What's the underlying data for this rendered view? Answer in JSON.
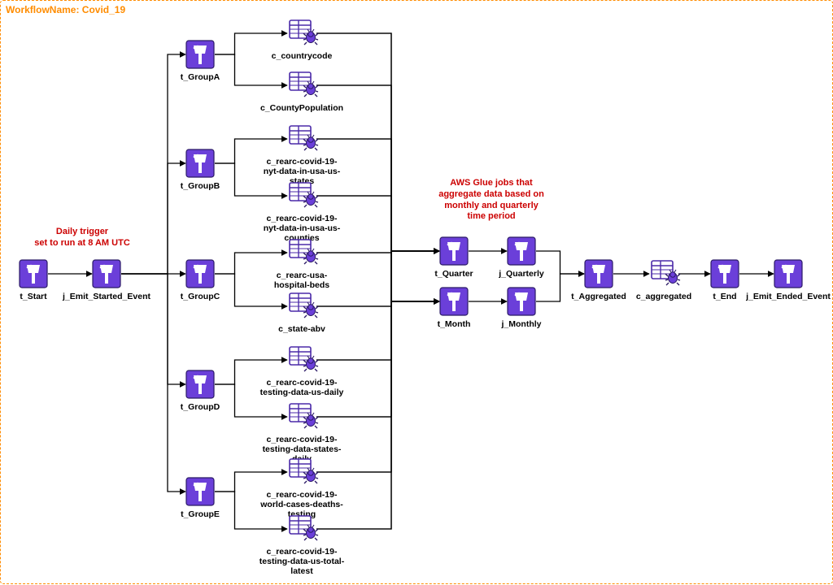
{
  "workflow": {
    "name_label": "WorkflowName:  Covid_19"
  },
  "annotations": {
    "daily_trigger": "Daily trigger\nset to run at 8 AM UTC",
    "aggregate_desc": "AWS Glue jobs that\naggregate data based on\nmonthly and quarterly\ntime period"
  },
  "nodes": {
    "t_Start": {
      "label": "t_Start",
      "kind": "trigger"
    },
    "j_Emit_Started_Event": {
      "label": "j_Emit_Started_Event",
      "kind": "trigger"
    },
    "t_GroupA": {
      "label": "t_GroupA",
      "kind": "trigger"
    },
    "t_GroupB": {
      "label": "t_GroupB",
      "kind": "trigger"
    },
    "t_GroupC": {
      "label": "t_GroupC",
      "kind": "trigger"
    },
    "t_GroupD": {
      "label": "t_GroupD",
      "kind": "trigger"
    },
    "t_GroupE": {
      "label": "t_GroupE",
      "kind": "trigger"
    },
    "c_countrycode": {
      "label": "c_countrycode",
      "kind": "crawler"
    },
    "c_CountyPopulation": {
      "label": "c_CountyPopulation",
      "kind": "crawler"
    },
    "c_rearc_nyt_states": {
      "label": "c_rearc-covid-19-\nnyt-data-in-usa-us-states",
      "kind": "crawler"
    },
    "c_rearc_nyt_counties": {
      "label": "c_rearc-covid-19-\nnyt-data-in-usa-us-counties",
      "kind": "crawler"
    },
    "c_rearc_hospital_beds": {
      "label": "c_rearc-usa-\nhospital-beds",
      "kind": "crawler"
    },
    "c_state_abv": {
      "label": "c_state-abv",
      "kind": "crawler"
    },
    "c_testing_us_daily": {
      "label": "c_rearc-covid-19-\ntesting-data-us-daily",
      "kind": "crawler"
    },
    "c_testing_states_daily": {
      "label": "c_rearc-covid-19-\ntesting-data-states-daily",
      "kind": "crawler"
    },
    "c_world_cases": {
      "label": "c_rearc-covid-19-\nworld-cases-deaths-testing",
      "kind": "crawler"
    },
    "c_testing_total_latest": {
      "label": "c_rearc-covid-19-\ntesting-data-us-total-latest",
      "kind": "crawler"
    },
    "t_Quarter": {
      "label": "t_Quarter",
      "kind": "trigger"
    },
    "j_Quarterly": {
      "label": "j_Quarterly",
      "kind": "trigger"
    },
    "t_Month": {
      "label": "t_Month",
      "kind": "trigger"
    },
    "j_Monthly": {
      "label": "j_Monthly",
      "kind": "trigger"
    },
    "t_Aggregated": {
      "label": "t_Aggregated",
      "kind": "trigger"
    },
    "c_aggregated": {
      "label": "c_aggregated",
      "kind": "crawler"
    },
    "t_End": {
      "label": "t_End",
      "kind": "trigger"
    },
    "j_Emit_Ended_Event": {
      "label": "j_Emit_Ended_Event",
      "kind": "trigger"
    }
  },
  "edges": [
    [
      "t_Start",
      "j_Emit_Started_Event"
    ],
    [
      "j_Emit_Started_Event",
      "t_GroupA"
    ],
    [
      "j_Emit_Started_Event",
      "t_GroupB"
    ],
    [
      "j_Emit_Started_Event",
      "t_GroupC"
    ],
    [
      "j_Emit_Started_Event",
      "t_GroupD"
    ],
    [
      "j_Emit_Started_Event",
      "t_GroupE"
    ],
    [
      "t_GroupA",
      "c_countrycode"
    ],
    [
      "t_GroupA",
      "c_CountyPopulation"
    ],
    [
      "t_GroupB",
      "c_rearc_nyt_states"
    ],
    [
      "t_GroupB",
      "c_rearc_nyt_counties"
    ],
    [
      "t_GroupC",
      "c_rearc_hospital_beds"
    ],
    [
      "t_GroupC",
      "c_state_abv"
    ],
    [
      "t_GroupD",
      "c_testing_us_daily"
    ],
    [
      "t_GroupD",
      "c_testing_states_daily"
    ],
    [
      "t_GroupE",
      "c_world_cases"
    ],
    [
      "t_GroupE",
      "c_testing_total_latest"
    ],
    [
      "c_countrycode",
      "t_Quarter"
    ],
    [
      "c_CountyPopulation",
      "t_Quarter"
    ],
    [
      "c_rearc_nyt_states",
      "t_Quarter"
    ],
    [
      "c_rearc_nyt_counties",
      "t_Quarter"
    ],
    [
      "c_rearc_hospital_beds",
      "t_Quarter"
    ],
    [
      "c_state_abv",
      "t_Quarter"
    ],
    [
      "c_testing_us_daily",
      "t_Quarter"
    ],
    [
      "c_testing_states_daily",
      "t_Quarter"
    ],
    [
      "c_world_cases",
      "t_Quarter"
    ],
    [
      "c_testing_total_latest",
      "t_Quarter"
    ],
    [
      "c_countrycode",
      "t_Month"
    ],
    [
      "c_CountyPopulation",
      "t_Month"
    ],
    [
      "c_rearc_nyt_states",
      "t_Month"
    ],
    [
      "c_rearc_nyt_counties",
      "t_Month"
    ],
    [
      "c_rearc_hospital_beds",
      "t_Month"
    ],
    [
      "c_state_abv",
      "t_Month"
    ],
    [
      "c_testing_us_daily",
      "t_Month"
    ],
    [
      "c_testing_states_daily",
      "t_Month"
    ],
    [
      "c_world_cases",
      "t_Month"
    ],
    [
      "c_testing_total_latest",
      "t_Month"
    ],
    [
      "t_Quarter",
      "j_Quarterly"
    ],
    [
      "t_Month",
      "j_Monthly"
    ],
    [
      "j_Quarterly",
      "t_Aggregated"
    ],
    [
      "j_Monthly",
      "t_Aggregated"
    ],
    [
      "t_Aggregated",
      "c_aggregated"
    ],
    [
      "c_aggregated",
      "t_End"
    ],
    [
      "t_End",
      "j_Emit_Ended_Event"
    ]
  ]
}
